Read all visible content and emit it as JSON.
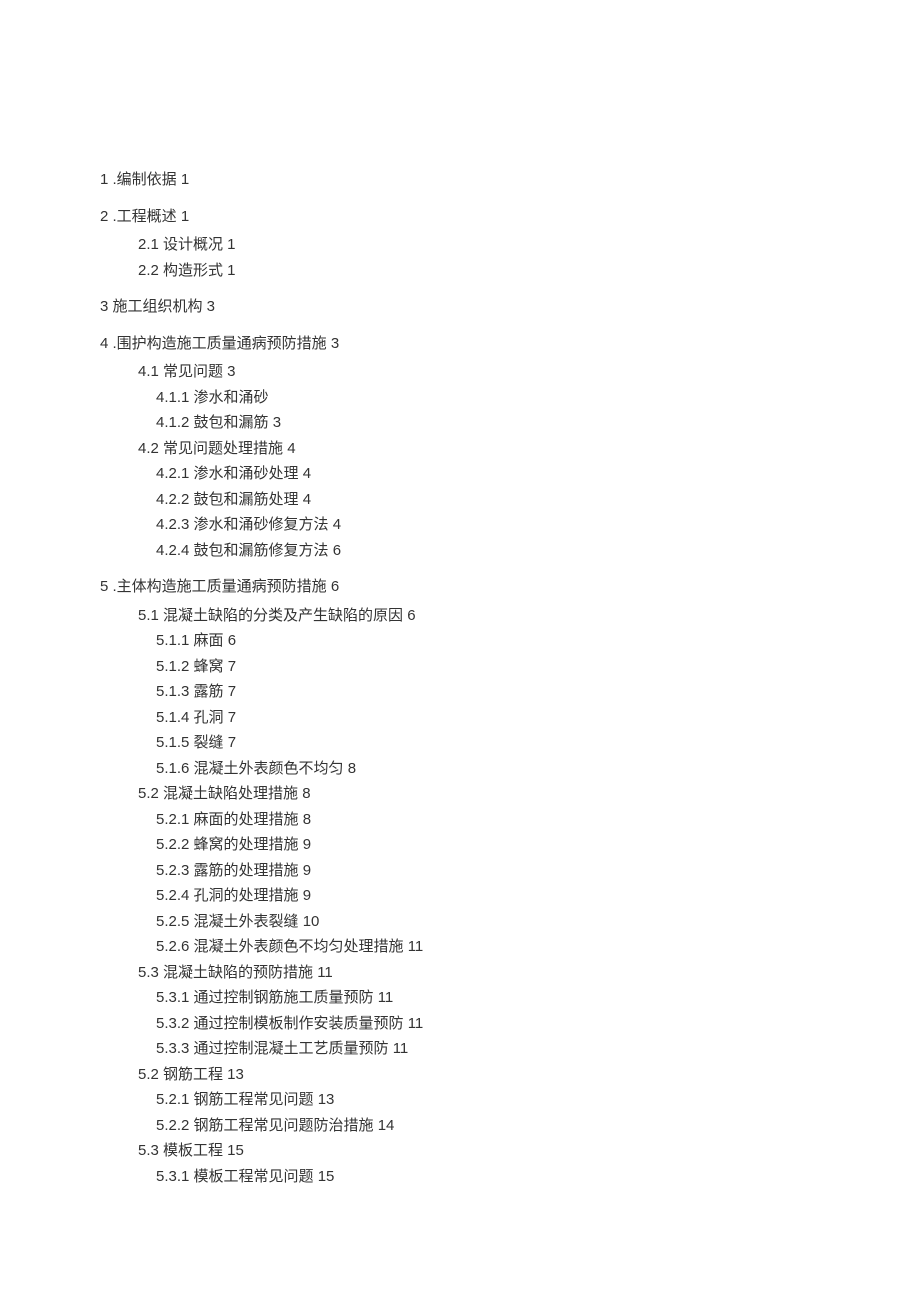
{
  "toc": [
    {
      "level": 1,
      "text": "1 .编制依据 1"
    },
    {
      "level": 1,
      "text": "2 .工程概述 1"
    },
    {
      "level": 2,
      "text": "2.1 设计概况 1"
    },
    {
      "level": 2,
      "text": "2.2 构造形式 1"
    },
    {
      "level": 1,
      "text": "3 施工组织机构 3"
    },
    {
      "level": 1,
      "text": "4 .围护构造施工质量通病预防措施 3"
    },
    {
      "level": 2,
      "text": "4.1 常见问题 3"
    },
    {
      "level": 3,
      "text": "4.1.1 渗水和涌砂"
    },
    {
      "level": 3,
      "text": "4.1.2 鼓包和漏筋 3"
    },
    {
      "level": 2,
      "text": "4.2 常见问题处理措施 4"
    },
    {
      "level": 3,
      "text": "4.2.1 渗水和涌砂处理 4"
    },
    {
      "level": 3,
      "text": "4.2.2 鼓包和漏筋处理 4"
    },
    {
      "level": 3,
      "text": "4.2.3 渗水和涌砂修复方法 4"
    },
    {
      "level": 3,
      "text": "4.2.4 鼓包和漏筋修复方法 6"
    },
    {
      "level": 1,
      "text": "5 .主体构造施工质量通病预防措施 6"
    },
    {
      "level": 2,
      "text": "5.1 混凝土缺陷的分类及产生缺陷的原因 6"
    },
    {
      "level": 3,
      "text": "5.1.1 麻面 6"
    },
    {
      "level": 3,
      "text": "5.1.2 蜂窝 7"
    },
    {
      "level": 3,
      "text": "5.1.3 露筋 7"
    },
    {
      "level": 3,
      "text": "5.1.4 孔洞 7"
    },
    {
      "level": 3,
      "text": "5.1.5 裂缝 7"
    },
    {
      "level": 3,
      "text": "5.1.6 混凝土外表颜色不均匀 8"
    },
    {
      "level": 2,
      "text": "5.2 混凝土缺陷处理措施 8"
    },
    {
      "level": 3,
      "text": "5.2.1 麻面的处理措施 8"
    },
    {
      "level": 3,
      "text": "5.2.2 蜂窝的处理措施 9"
    },
    {
      "level": 3,
      "text": "5.2.3 露筋的处理措施 9"
    },
    {
      "level": 3,
      "text": "5.2.4 孔洞的处理措施 9"
    },
    {
      "level": 3,
      "text": "5.2.5 混凝土外表裂缝 10"
    },
    {
      "level": 3,
      "text": "5.2.6 混凝土外表颜色不均匀处理措施 11"
    },
    {
      "level": 2,
      "text": "5.3 混凝土缺陷的预防措施 11"
    },
    {
      "level": 3,
      "text": "5.3.1 通过控制钢筋施工质量预防 11"
    },
    {
      "level": 3,
      "text": "5.3.2 通过控制模板制作安装质量预防 11"
    },
    {
      "level": 3,
      "text": "5.3.3 通过控制混凝土工艺质量预防 11"
    },
    {
      "level": 2,
      "text": "5.2 钢筋工程 13"
    },
    {
      "level": 3,
      "text": "5.2.1 钢筋工程常见问题 13"
    },
    {
      "level": 3,
      "text": "5.2.2 钢筋工程常见问题防治措施 14"
    },
    {
      "level": 2,
      "text": "5.3 模板工程 15"
    },
    {
      "level": 3,
      "text": "5.3.1 模板工程常见问题 15"
    }
  ]
}
